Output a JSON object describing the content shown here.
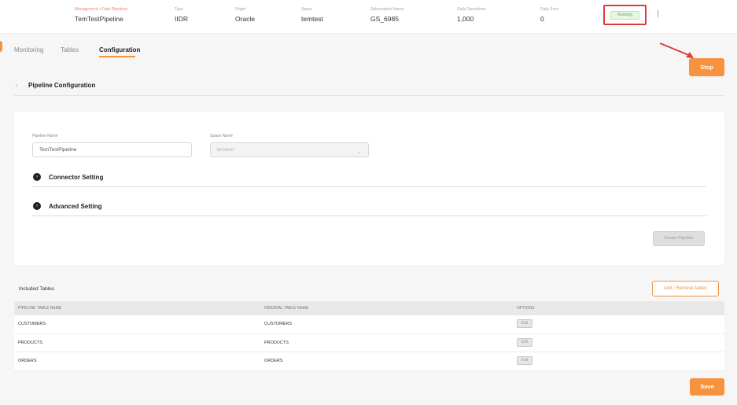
{
  "header": {
    "breadcrumb": "Management > Data Pipelines",
    "pipeline_name": "TemTestPipeline",
    "type_label": "Type",
    "type_value": "IIDR",
    "origin_label": "Origin",
    "origin_value": "Oracle",
    "space_label": "Space",
    "space_value": "temtest",
    "subscription_label": "Subscription Name",
    "subscription_value": "GS_6985",
    "daily_ops_label": "Daily Operations",
    "daily_ops_value": "1,000",
    "daily_error_label": "Daily Error",
    "daily_error_value": "0",
    "status": "Running"
  },
  "tabs": [
    {
      "label": "Monitoring"
    },
    {
      "label": "Tables"
    },
    {
      "label": "Configuration"
    }
  ],
  "stop_label": "Stop",
  "section": {
    "back_icon": "‹",
    "title": "Pipeline Configuration"
  },
  "form": {
    "pipeline_name_label": "Pipeline Name",
    "pipeline_name_value": "TemTestPipeline",
    "space_name_label": "Space Name",
    "space_name_value": "temtest",
    "connector_setting": "Connector Setting",
    "advanced_setting": "Advanced Setting",
    "create_label": "Create Pipeline"
  },
  "tables": {
    "title": "Included Tables",
    "add_remove_label": "Add / Remove tables",
    "columns": [
      "PIPELINE TABLE NAME",
      "ORIGINAL TABLE NAME",
      "OPTIONS"
    ],
    "rows": [
      {
        "pipeline": "CUSTOMERS",
        "original": "CUSTOMERS",
        "option": "Edit"
      },
      {
        "pipeline": "PRODUCTS",
        "original": "PRODUCTS",
        "option": "Edit"
      },
      {
        "pipeline": "ORDERS",
        "original": "ORDERS",
        "option": "Edit"
      }
    ]
  },
  "save_label": "Save",
  "colors": {
    "accent": "#f7923f",
    "status_green": "#5aa845",
    "highlight_red": "#e03a3a"
  }
}
